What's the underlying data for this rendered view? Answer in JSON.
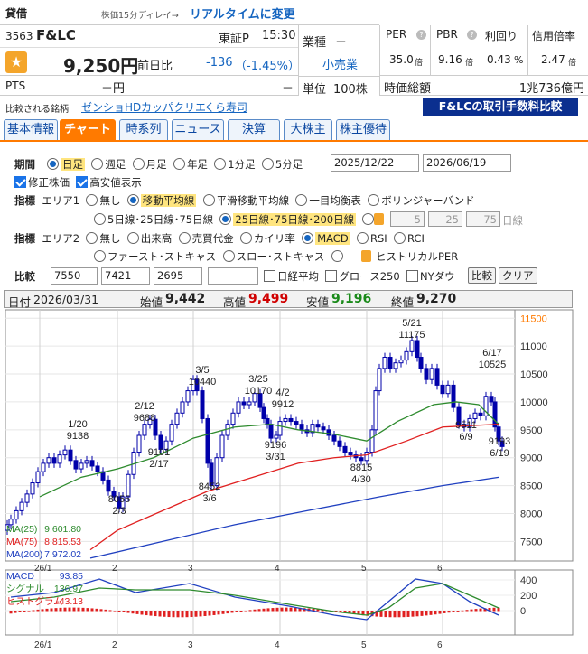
{
  "header": {
    "category": "貸借",
    "delay_note": "株価15分ディレイ→",
    "realtime_link": "リアルタイムに変更",
    "code": "3563",
    "name": "F&LC",
    "market": "東証P",
    "time": "15:30",
    "price": "9,250円",
    "prev_label": "前日比",
    "change": "-136",
    "change_pct": "（-1.45%）",
    "pts_label": "PTS",
    "pts_value": "－円",
    "pts_change": "－",
    "industry_label": "業種",
    "industry_dash": "－",
    "industry_link": "小売業",
    "unit_label": "単位",
    "unit_value": "100株",
    "metrics": [
      {
        "label": "PER",
        "value": "35.0",
        "unit": "倍"
      },
      {
        "label": "PBR",
        "value": "9.16",
        "unit": "倍"
      },
      {
        "label": "利回り",
        "value": "0.43",
        "unit": "%"
      },
      {
        "label": "信用倍率",
        "value": "2.47",
        "unit": "倍"
      }
    ],
    "mcap_label": "時価総額",
    "mcap_value": "1兆736億円",
    "compare_label": "比較される銘柄",
    "compare_links": [
      "ゼンショHD",
      "カッパクリエ",
      "くら寿司"
    ],
    "fee_banner": "F&LCの取引手数料比較"
  },
  "tabs": [
    "基本情報",
    "チャート",
    "時系列",
    "ニュース",
    "決算",
    "大株主",
    "株主優待"
  ],
  "controls": {
    "period_label": "期間",
    "periods": [
      "日足",
      "週足",
      "月足",
      "年足",
      "1分足",
      "5分足"
    ],
    "date_from": "2025/12/22",
    "date_to": "2026/06/19",
    "adj_label": "修正株価",
    "hl_label": "高安値表示",
    "indicator_label": "指標",
    "area1_label": "エリア1",
    "area1_opts": [
      "無し",
      "移動平均線",
      "平滑移動平均線",
      "一目均衡表",
      "ボリンジャーバンド"
    ],
    "ma_opts": [
      "5日線･25日線･75日線",
      "25日線･75日線･200日線"
    ],
    "ma_inputs": [
      "5",
      "25",
      "75"
    ],
    "ma_unit": "日線",
    "area2_label": "エリア2",
    "area2_opts": [
      "無し",
      "出来高",
      "売買代金",
      "カイリ率",
      "MACD",
      "RSI",
      "RCI"
    ],
    "area2_opts2": [
      "ファースト･ストキャス",
      "スロー･ストキャス",
      "ヒストリカルPER"
    ],
    "compare_label": "比較",
    "compare_codes": [
      "7550",
      "7421",
      "2695",
      ""
    ],
    "nikkei_label": "日経平均",
    "growth_label": "グロース250",
    "ny_label": "NYダウ",
    "compare_btn": "比較",
    "clear_btn": "クリア"
  },
  "ohlc": {
    "date_label": "日付",
    "date": "2026/03/31",
    "open_label": "始値",
    "open": "9,442",
    "high_label": "高値",
    "high": "9,499",
    "low_label": "安値",
    "low": "9,196",
    "close_label": "終値",
    "close": "9,270"
  },
  "chart_data": {
    "type": "candlestick",
    "y_ticks": [
      7500,
      8000,
      8500,
      9000,
      9500,
      10000,
      10500,
      11000,
      11500
    ],
    "ylim": [
      7150,
      11650
    ],
    "x_labels": [
      "26/1",
      "2",
      "3",
      "4",
      "5",
      "6"
    ],
    "colors": {
      "up": "#0000cc",
      "down": "#0000cc",
      "ma25": "#2e8b2e",
      "ma75": "#e02020",
      "ma200": "#2040c0",
      "accent": "#ff7a00"
    },
    "ma_legend": [
      {
        "name": "MA(25)",
        "value": "9,601.80",
        "color": "#2e8b2e"
      },
      {
        "name": "MA(75)",
        "value": "8,815.53",
        "color": "#e02020"
      },
      {
        "name": "MA(200)",
        "value": "7,972.02",
        "color": "#2040c0"
      }
    ],
    "annotations": [
      {
        "date": "1/20",
        "price": "9138"
      },
      {
        "date": "2/3",
        "price": "8055"
      },
      {
        "date": "2/12",
        "price": "9688"
      },
      {
        "date": "2/17",
        "price": "9101"
      },
      {
        "date": "3/5",
        "price": "10440"
      },
      {
        "date": "3/6",
        "price": "8452"
      },
      {
        "date": "3/25",
        "price": "10170"
      },
      {
        "date": "4/2",
        "price": "9912"
      },
      {
        "date": "3/31",
        "price": "9196"
      },
      {
        "date": "4/30",
        "price": "8815"
      },
      {
        "date": "5/21",
        "price": "11175"
      },
      {
        "date": "6/9",
        "price": "9511"
      },
      {
        "date": "6/17",
        "price": "10525"
      },
      {
        "date": "6/19",
        "price": "9193"
      }
    ],
    "macd": {
      "y_ticks": [
        400,
        200,
        0
      ],
      "legend": [
        {
          "name": "MACD",
          "value": "93.85",
          "color": "#2040c0"
        },
        {
          "name": "シグナル",
          "value": "136.97",
          "color": "#2e8b2e"
        },
        {
          "name": "ヒストグラム",
          "value": "-43.13",
          "color": "#e02020"
        }
      ]
    }
  }
}
